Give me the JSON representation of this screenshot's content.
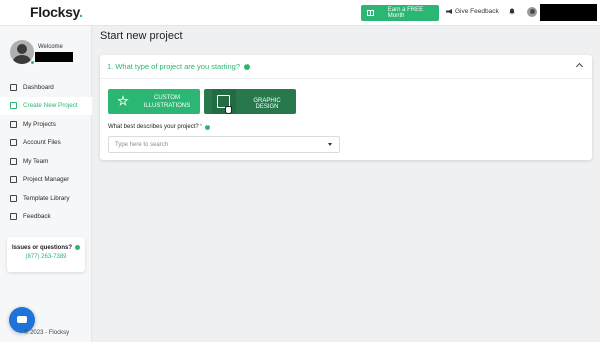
{
  "header": {
    "logo_text": "Flocksy",
    "earn_label": "Earn a FREE Month",
    "feedback_label": "Give Feedback"
  },
  "sidebar": {
    "welcome": "Welcome",
    "items": [
      {
        "label": "Dashboard",
        "icon": "dashboard-icon"
      },
      {
        "label": "Create New Project",
        "icon": "edit-icon",
        "active": true
      },
      {
        "label": "My Projects",
        "icon": "document-icon"
      },
      {
        "label": "Account Files",
        "icon": "folder-icon"
      },
      {
        "label": "My Team",
        "icon": "user-icon"
      },
      {
        "label": "Project Manager",
        "icon": "manager-icon"
      },
      {
        "label": "Template Library",
        "icon": "template-icon"
      },
      {
        "label": "Feedback",
        "icon": "feedback-icon"
      }
    ],
    "support": {
      "question": "Issues or questions?",
      "phone": "(877) 263-7389"
    },
    "copyright": "© 2023 - Flocksy"
  },
  "main": {
    "title": "Start new project",
    "question": "1. What type of project are you starting?",
    "buttons": {
      "custom_line1": "CUSTOM",
      "custom_line2": "ILLUSTRATIONS",
      "graphic": "GRAPHIC DESIGN"
    },
    "describe_label": "What best describes your project?",
    "required_mark": "*",
    "search_placeholder": "Type here to search"
  },
  "colors": {
    "brand": "#2bb673",
    "brand_dark": "#27794c",
    "chat": "#1e74d9"
  }
}
